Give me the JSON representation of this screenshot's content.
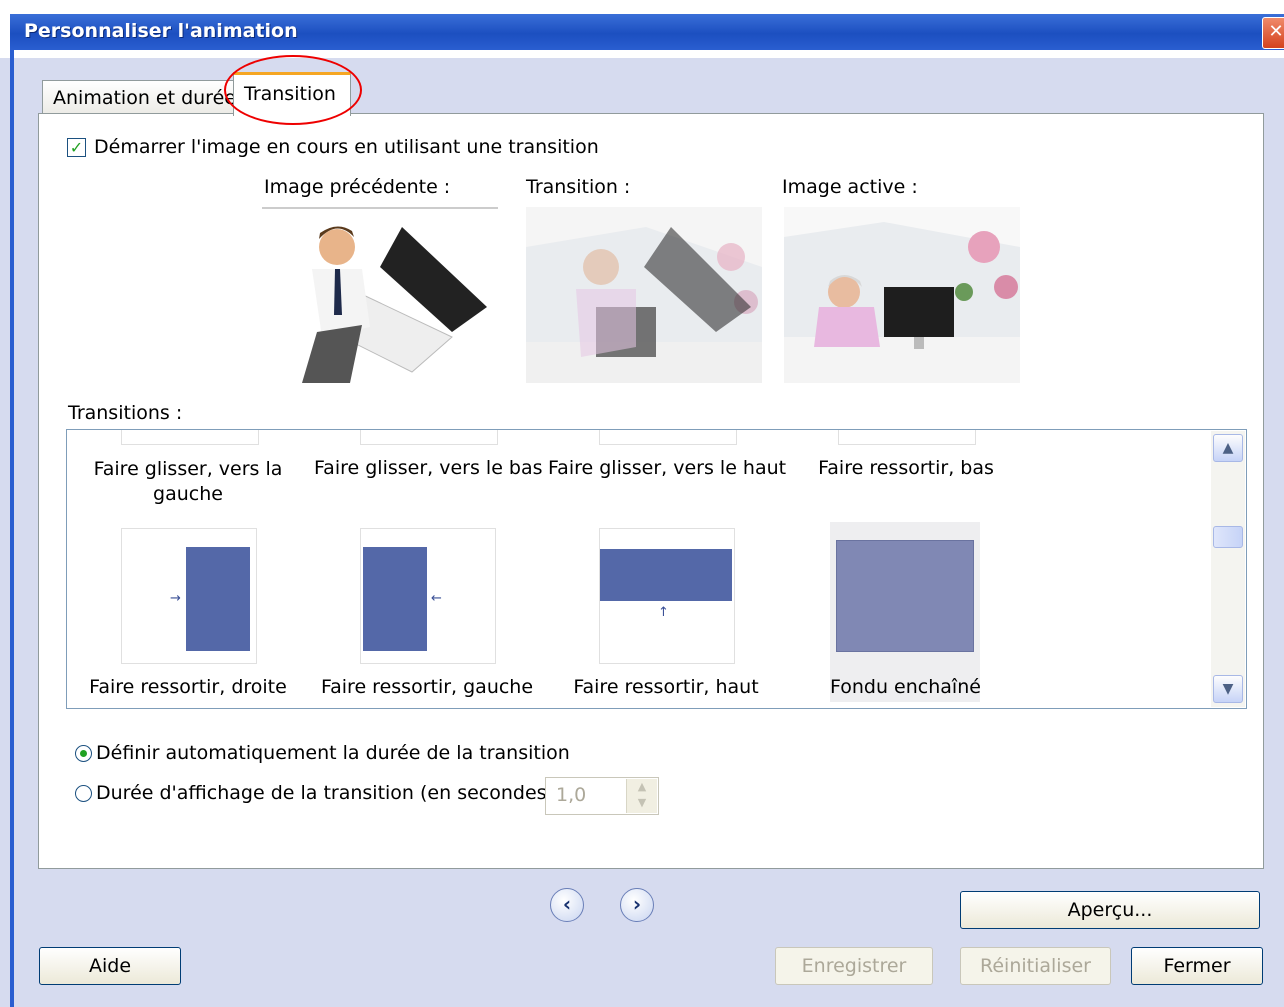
{
  "window": {
    "title": "Personnaliser l'animation",
    "close_glyph": "✕"
  },
  "tabs": [
    {
      "label": "Animation et durée",
      "active": false
    },
    {
      "label": "Transition",
      "active": true
    }
  ],
  "start_checkbox": {
    "label": "Démarrer l'image en cours en utilisant une transition",
    "checked": true
  },
  "preview": {
    "previous_label": "Image précédente :",
    "transition_label": "Transition :",
    "active_label": "Image active :"
  },
  "transitions": {
    "label": "Transitions :",
    "row1": [
      "Faire glisser, vers la gauche",
      "Faire glisser, vers le bas",
      "Faire glisser, vers le haut",
      "Faire ressortir, bas"
    ],
    "row2": [
      "Faire ressortir, droite",
      "Faire ressortir, gauche",
      "Faire ressortir, haut",
      "Fondu enchaîné"
    ],
    "selected": "Fondu enchaîné"
  },
  "duration": {
    "auto_label": "Définir automatiquement la durée de la transition",
    "manual_label": "Durée d'affichage de la transition (en secondes)",
    "value": "1,0",
    "auto_selected": true
  },
  "buttons": {
    "preview": "Aperçu...",
    "help": "Aide",
    "save": "Enregistrer",
    "reset": "Réinitialiser",
    "close": "Fermer"
  },
  "colors": {
    "accent": "#2a5ed0",
    "tab_highlight": "#f5a623",
    "annotation": "#e00000",
    "tile": "#5468a8"
  }
}
